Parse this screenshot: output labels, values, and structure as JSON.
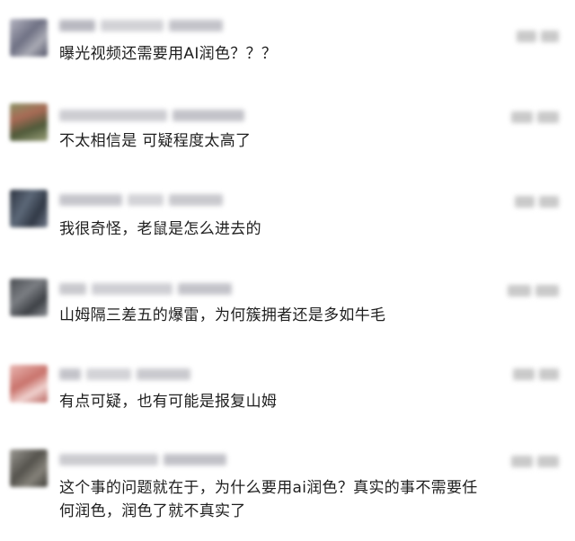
{
  "comments": [
    {
      "text": "曝光视频还需要用AI润色？？？",
      "avatar_color": "#8d8f9c"
    },
    {
      "text": "不太相信是 可疑程度太高了",
      "avatar_color": "#6b7456"
    },
    {
      "text": "我很奇怪，老鼠是怎么进去的",
      "avatar_color": "#3c4450"
    },
    {
      "text": "山姆隔三差五的爆雷，为何簇拥者还是多如牛毛",
      "avatar_color": "#5b5e63"
    },
    {
      "text": "有点可疑，也有可能是报复山姆",
      "avatar_color": "#d79a96"
    },
    {
      "text": "这个事的问题就在于，为什么要用ai润色？真实的事不需要任\n何润色，润色了就不真实了",
      "avatar_color": "#6e6c66"
    }
  ]
}
